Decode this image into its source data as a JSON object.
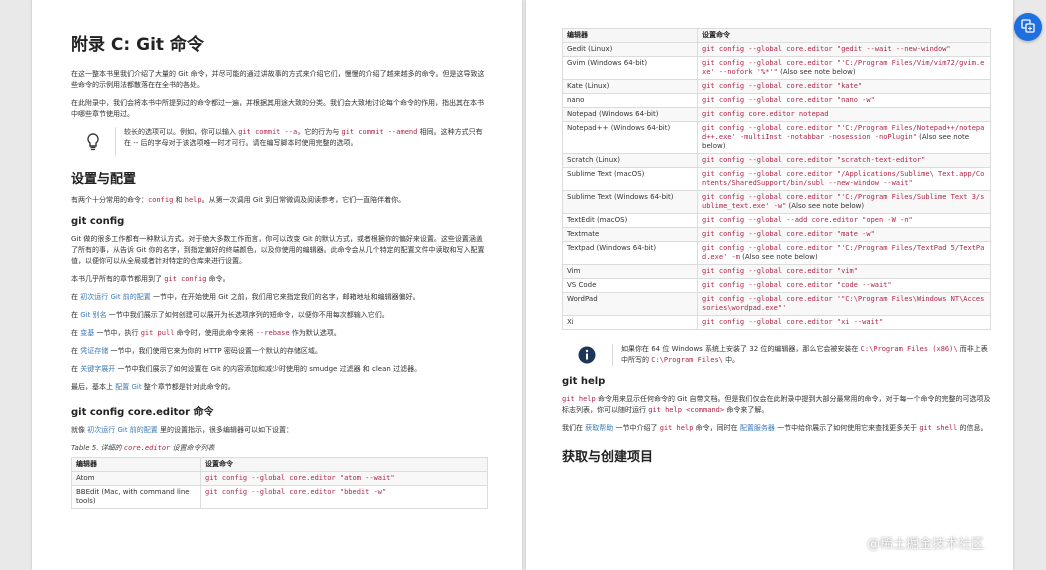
{
  "left": {
    "title": "附录 C: Git 命令",
    "intro": [
      "在这一整本书里我们介绍了大量的 Git 命令，并尽可能的通过讲故事的方式来介绍它们，慢慢的介绍了越来越多的命令。但是这导致这些命令的示例用法都散落在在全书的各处。",
      "在此附录中，我们会将本书中所提到过的命令都过一遍，并根据其用途大致的分类。我们会大致地讨论每个命令的作用，指出其在本书中哪些章节使用过。"
    ],
    "tip": {
      "t1": "较长的选项可以。例如，你可以输入 ",
      "c1": "git commit --a",
      "t2": "，它的行为与 ",
      "c2": "git commit --amend",
      "t3": " 相同。这种方式只有在 -- 后的字母对于该选项唯一时才可行。请在编写脚本时使用完整的选项。"
    },
    "h_setup": "设置与配置",
    "setup_p": {
      "t1": "有两个十分常用的命令：",
      "c1": "config",
      "t2": " 和 ",
      "c2": "help",
      "t3": "。从第一次调用 Git 到日常微调及阅读参考，它们一直陪伴着你。"
    },
    "h_config": "git config",
    "config_p1": "Git 做的很多工作都有一种默认方式。对于绝大多数工作而言，你可以改变 Git 的默认方式，或者根据你的偏好来设置。这些设置涵盖了所有的事，从告诉 Git 你的名字，到指定偏好的终端颜色，以及你使用的编辑器。此命令会从几个特定的配置文件中读取和写入配置值，以便你可以从全局或者针对特定的仓库来进行设置。",
    "config_p2": {
      "t1": "本书几乎所有的章节都用到了 ",
      "c1": "git config",
      "t2": " 命令。"
    },
    "config_p3": {
      "t1": "在 ",
      "a1": "初次运行 Git 前的配置",
      "t2": " 一节中，在开始使用 Git 之前，我们用它来指定我们的名字，邮箱地址和编辑器偏好。"
    },
    "config_p4": {
      "t1": "在 ",
      "a1": "Git 别名",
      "t2": " 一节中我们展示了如何创建可以展开为长选项序列的短命令，以便你不用每次都输入它们。"
    },
    "config_p5": {
      "t1": "在 ",
      "a1": "变基",
      "t2": " 一节中，执行 ",
      "c1": "git pull",
      "t3": " 命令时，使用此命令来将 ",
      "c2": "--rebase",
      "t4": " 作为默认选项。"
    },
    "config_p6": {
      "t1": "在 ",
      "a1": "凭证存储",
      "t2": " 一节中，我们使用它来为你的 HTTP 密码设置一个默认的存储区域。"
    },
    "config_p7": {
      "t1": "在 ",
      "a1": "关键字展开",
      "t2": " 一节中我们展示了如何设置在 Git 的内容添加和减少时使用的 smudge 过滤器 和 clean 过滤器。"
    },
    "config_p8": {
      "t1": "最后，基本上 ",
      "a1": "配置 Git",
      "t2": " 整个章节都是针对此命令的。"
    },
    "h_editor": "git config core.editor 命令",
    "editor_p": {
      "t1": "就像 ",
      "a1": "初次运行 Git 前的配置",
      "t2": " 里的设置指示，很多编辑器可以如下设置："
    },
    "caption": {
      "t1": "Table 5. 详细的 ",
      "c1": "core.editor",
      "t2": " 设置命令列表"
    },
    "table_head": [
      "编辑器",
      "设置命令"
    ],
    "rows": [
      {
        "editor": "Atom",
        "cmd": "git config --global core.editor \"atom --wait\""
      },
      {
        "editor": "BBEdit (Mac, with command line tools)",
        "cmd": "git config --global core.editor \"bbedit -w\""
      }
    ]
  },
  "right": {
    "table_head": [
      "编辑器",
      "设置命令"
    ],
    "rows": [
      {
        "editor": "Gedit (Linux)",
        "cmd": "git config --global core.editor \"gedit --wait --new-window\"",
        "note": ""
      },
      {
        "editor": "Gvim (Windows 64-bit)",
        "cmd": "git config --global core.editor \"'C:/Program Files/Vim/vim72/gvim.exe' --nofork '%*'\"",
        "note": " (Also see note below)"
      },
      {
        "editor": "Kate (Linux)",
        "cmd": "git config --global core.editor \"kate\"",
        "note": ""
      },
      {
        "editor": "nano",
        "cmd": "git config --global core.editor \"nano -w\"",
        "note": ""
      },
      {
        "editor": "Notepad (Windows 64-bit)",
        "cmd": "git config core.editor notepad",
        "note": ""
      },
      {
        "editor": "Notepad++ (Windows 64-bit)",
        "cmd": "git config --global core.editor \"'C:/Program Files/Notepad++/notepad++.exe' -multiInst -notabbar -nosession -noPlugin\"",
        "note": " (Also see note below)"
      },
      {
        "editor": "Scratch (Linux)",
        "cmd": "git config --global core.editor \"scratch-text-editor\"",
        "note": ""
      },
      {
        "editor": "Sublime Text (macOS)",
        "cmd": "git config --global core.editor \"/Applications/Sublime\\ Text.app/Contents/SharedSupport/bin/subl --new-window --wait\"",
        "note": ""
      },
      {
        "editor": "Sublime Text (Windows 64-bit)",
        "cmd": "git config --global core.editor \"'C:/Program Files/Sublime Text 3/sublime_text.exe' -w\"",
        "note": " (Also see note below)"
      },
      {
        "editor": "TextEdit (macOS)",
        "cmd": "git config --global --add core.editor \"open -W -n\"",
        "note": ""
      },
      {
        "editor": "Textmate",
        "cmd": "git config --global core.editor \"mate -w\"",
        "note": ""
      },
      {
        "editor": "Textpad (Windows 64-bit)",
        "cmd": "git config --global core.editor \"'C:/Program Files/TextPad 5/TextPad.exe' -m",
        "note": " (Also see note below)"
      },
      {
        "editor": "Vim",
        "cmd": "git config --global core.editor \"vim\"",
        "note": ""
      },
      {
        "editor": "VS Code",
        "cmd": "git config --global core.editor \"code --wait\"",
        "note": ""
      },
      {
        "editor": "WordPad",
        "cmd": "git config --global core.editor '\"C:\\Program Files\\Windows NT\\Accessories\\wordpad.exe\"'",
        "note": ""
      },
      {
        "editor": "Xi",
        "cmd": "git config --global core.editor \"xi --wait\"",
        "note": ""
      }
    ],
    "note": {
      "t1": "如果你在 64 位 Windows 系统上安装了 32 位的编辑器，那么它会被安装在 ",
      "c1": "C:\\Program Files (x86)\\",
      "t2": " 而非上表中所写的 ",
      "c2": "C:\\Program Files\\",
      "t3": " 中。"
    },
    "h_help": "git help",
    "help_p1": {
      "c1": "git help",
      "t1": " 命令用来显示任何命令的 Git 自带文档。但是我们仅会在此附录中提到大部分最常用的命令，对于每一个命令的完整的可选项及标志列表，你可以随时运行 ",
      "c2": "git help <command>",
      "t2": " 命令来了解。"
    },
    "help_p2": {
      "t1": "我们在 ",
      "a1": "获取帮助",
      "t2": " 一节中介绍了 ",
      "c1": "git help",
      "t3": " 命令，同时在 ",
      "a2": "配置服务器",
      "t4": " 一节中给你展示了如何使用它来查找更多关于 ",
      "c2": "git shell",
      "t5": " 的信息。"
    },
    "h_get": "获取与创建项目"
  },
  "watermark": "@稀土掘金技术社区",
  "icons": {
    "tip": "lightbulb-icon",
    "note": "info-icon",
    "fab": "translate-icon"
  }
}
